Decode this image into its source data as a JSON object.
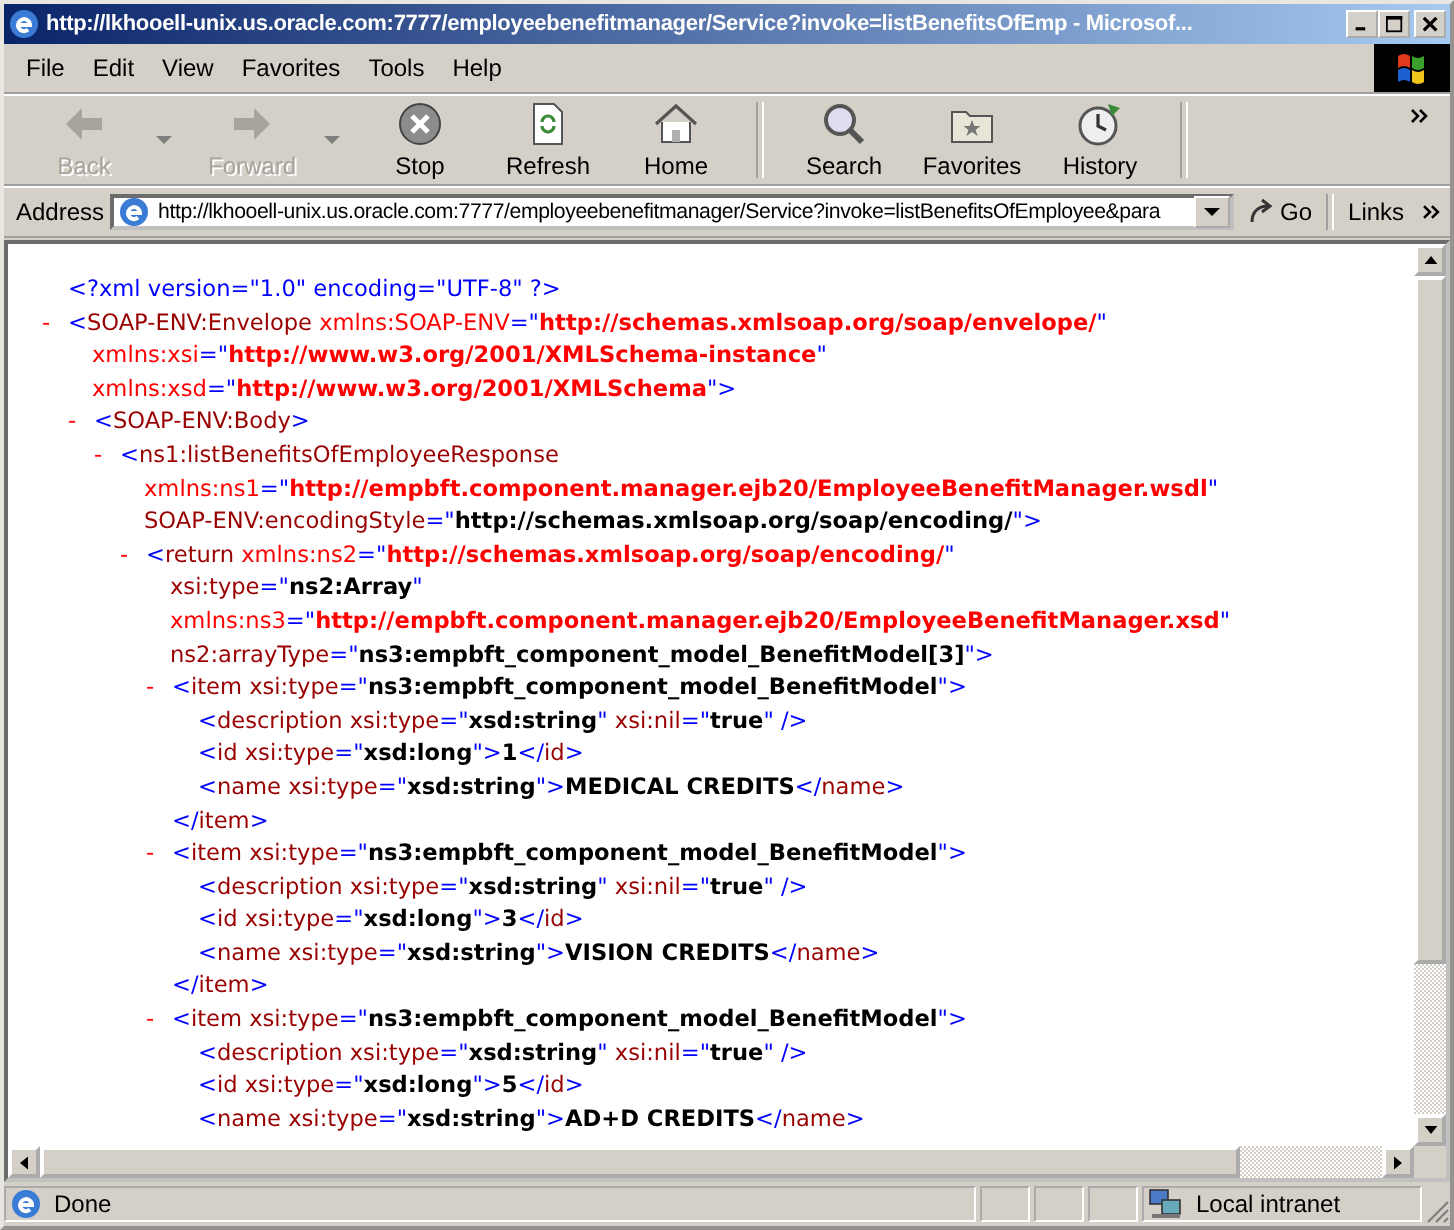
{
  "window": {
    "title": "http://lkhooell-unix.us.oracle.com:7777/employeebenefitmanager/Service?invoke=listBenefitsOfEmp - Microsof..."
  },
  "menu": [
    "File",
    "Edit",
    "View",
    "Favorites",
    "Tools",
    "Help"
  ],
  "toolbar": [
    {
      "kind": "back",
      "label": "Back",
      "disabled": true,
      "dropdown": true
    },
    {
      "kind": "forward",
      "label": "Forward",
      "disabled": true,
      "dropdown": true
    },
    {
      "kind": "stop",
      "label": "Stop",
      "disabled": false
    },
    {
      "kind": "refresh",
      "label": "Refresh",
      "disabled": false
    },
    {
      "kind": "home",
      "label": "Home",
      "disabled": false
    },
    {
      "kind": "search",
      "label": "Search",
      "disabled": false
    },
    {
      "kind": "favorites",
      "label": "Favorites",
      "disabled": false
    },
    {
      "kind": "history",
      "label": "History",
      "disabled": false
    }
  ],
  "address": {
    "label": "Address",
    "value": "http://lkhooell-unix.us.oracle.com:7777/employeebenefitmanager/Service?invoke=listBenefitsOfEmployee&para",
    "go": "Go",
    "links": "Links"
  },
  "document": {
    "declaration": [
      {
        "kind": "mark",
        "text": "<?xml version=\"1.0\" encoding=\"UTF-8\" ?>"
      }
    ],
    "nodes": [
      {
        "toggle": "-",
        "lines": [
          [
            {
              "kind": "mark",
              "text": "<"
            },
            {
              "kind": "tag",
              "text": "SOAP-ENV:Envelope"
            },
            {
              "kind": "nsattr",
              "text": " xmlns:SOAP-ENV"
            },
            {
              "kind": "mark",
              "text": "=\""
            },
            {
              "kind": "nsvalue",
              "text": "http://schemas.xmlsoap.org/soap/envelope/"
            },
            {
              "kind": "mark",
              "text": "\""
            }
          ],
          [
            {
              "kind": "nsattr",
              "text": "xmlns:xsi"
            },
            {
              "kind": "mark",
              "text": "=\""
            },
            {
              "kind": "nsvalue",
              "text": "http://www.w3.org/2001/XMLSchema-instance"
            },
            {
              "kind": "mark",
              "text": "\""
            }
          ],
          [
            {
              "kind": "nsattr",
              "text": "xmlns:xsd"
            },
            {
              "kind": "mark",
              "text": "=\""
            },
            {
              "kind": "nsvalue",
              "text": "http://www.w3.org/2001/XMLSchema"
            },
            {
              "kind": "mark",
              "text": "\">"
            }
          ]
        ],
        "children": [
          {
            "toggle": "-",
            "lines": [
              [
                {
                  "kind": "mark",
                  "text": "<"
                },
                {
                  "kind": "tag",
                  "text": "SOAP-ENV:Body"
                },
                {
                  "kind": "mark",
                  "text": ">"
                }
              ]
            ],
            "children": [
              {
                "toggle": "-",
                "lines": [
                  [
                    {
                      "kind": "mark",
                      "text": "<"
                    },
                    {
                      "kind": "tag",
                      "text": "ns1:listBenefitsOfEmployeeResponse"
                    }
                  ],
                  [
                    {
                      "kind": "nsattr",
                      "text": "xmlns:ns1"
                    },
                    {
                      "kind": "mark",
                      "text": "=\""
                    },
                    {
                      "kind": "nsvalue",
                      "text": "http://empbft.component.manager.ejb20/EmployeeBenefitManager.wsdl"
                    },
                    {
                      "kind": "mark",
                      "text": "\""
                    }
                  ],
                  [
                    {
                      "kind": "attr",
                      "text": "SOAP-ENV:encodingStyle"
                    },
                    {
                      "kind": "mark",
                      "text": "=\""
                    },
                    {
                      "kind": "value",
                      "text": "http://schemas.xmlsoap.org/soap/encoding/"
                    },
                    {
                      "kind": "mark",
                      "text": "\">"
                    }
                  ]
                ],
                "children": [
                  {
                    "toggle": "-",
                    "lines": [
                      [
                        {
                          "kind": "mark",
                          "text": "<"
                        },
                        {
                          "kind": "tag",
                          "text": "return"
                        },
                        {
                          "kind": "nsattr",
                          "text": " xmlns:ns2"
                        },
                        {
                          "kind": "mark",
                          "text": "=\""
                        },
                        {
                          "kind": "nsvalue",
                          "text": "http://schemas.xmlsoap.org/soap/encoding/"
                        },
                        {
                          "kind": "mark",
                          "text": "\""
                        }
                      ],
                      [
                        {
                          "kind": "attr",
                          "text": "xsi:type"
                        },
                        {
                          "kind": "mark",
                          "text": "=\""
                        },
                        {
                          "kind": "value",
                          "text": "ns2:Array"
                        },
                        {
                          "kind": "mark",
                          "text": "\""
                        }
                      ],
                      [
                        {
                          "kind": "nsattr",
                          "text": "xmlns:ns3"
                        },
                        {
                          "kind": "mark",
                          "text": "=\""
                        },
                        {
                          "kind": "nsvalue",
                          "text": "http://empbft.component.manager.ejb20/EmployeeBenefitManager.xsd"
                        },
                        {
                          "kind": "mark",
                          "text": "\""
                        }
                      ],
                      [
                        {
                          "kind": "attr",
                          "text": "ns2:arrayType"
                        },
                        {
                          "kind": "mark",
                          "text": "=\""
                        },
                        {
                          "kind": "value",
                          "text": "ns3:empbft_component_model_BenefitModel[3]"
                        },
                        {
                          "kind": "mark",
                          "text": "\">"
                        }
                      ]
                    ],
                    "children": [
                      {
                        "toggle": "-",
                        "lines": [
                          [
                            {
                              "kind": "mark",
                              "text": "<"
                            },
                            {
                              "kind": "tag",
                              "text": "item"
                            },
                            {
                              "kind": "attr",
                              "text": " xsi:type"
                            },
                            {
                              "kind": "mark",
                              "text": "=\""
                            },
                            {
                              "kind": "value",
                              "text": "ns3:empbft_component_model_BenefitModel"
                            },
                            {
                              "kind": "mark",
                              "text": "\">"
                            }
                          ]
                        ],
                        "children": [
                          {
                            "lines": [
                              [
                                {
                                  "kind": "mark",
                                  "text": "<"
                                },
                                {
                                  "kind": "tag",
                                  "text": "description"
                                },
                                {
                                  "kind": "attr",
                                  "text": " xsi:type"
                                },
                                {
                                  "kind": "mark",
                                  "text": "=\""
                                },
                                {
                                  "kind": "value",
                                  "text": "xsd:string"
                                },
                                {
                                  "kind": "mark",
                                  "text": "\""
                                },
                                {
                                  "kind": "attr",
                                  "text": " xsi:nil"
                                },
                                {
                                  "kind": "mark",
                                  "text": "=\""
                                },
                                {
                                  "kind": "value",
                                  "text": "true"
                                },
                                {
                                  "kind": "mark",
                                  "text": "\" />"
                                }
                              ]
                            ]
                          },
                          {
                            "lines": [
                              [
                                {
                                  "kind": "mark",
                                  "text": "<"
                                },
                                {
                                  "kind": "tag",
                                  "text": "id"
                                },
                                {
                                  "kind": "attr",
                                  "text": " xsi:type"
                                },
                                {
                                  "kind": "mark",
                                  "text": "=\""
                                },
                                {
                                  "kind": "value",
                                  "text": "xsd:long"
                                },
                                {
                                  "kind": "mark",
                                  "text": "\">"
                                },
                                {
                                  "kind": "text",
                                  "text": "1"
                                },
                                {
                                  "kind": "mark",
                                  "text": "</"
                                },
                                {
                                  "kind": "tag",
                                  "text": "id"
                                },
                                {
                                  "kind": "mark",
                                  "text": ">"
                                }
                              ]
                            ]
                          },
                          {
                            "lines": [
                              [
                                {
                                  "kind": "mark",
                                  "text": "<"
                                },
                                {
                                  "kind": "tag",
                                  "text": "name"
                                },
                                {
                                  "kind": "attr",
                                  "text": " xsi:type"
                                },
                                {
                                  "kind": "mark",
                                  "text": "=\""
                                },
                                {
                                  "kind": "value",
                                  "text": "xsd:string"
                                },
                                {
                                  "kind": "mark",
                                  "text": "\">"
                                },
                                {
                                  "kind": "text",
                                  "text": "MEDICAL CREDITS"
                                },
                                {
                                  "kind": "mark",
                                  "text": "</"
                                },
                                {
                                  "kind": "tag",
                                  "text": "name"
                                },
                                {
                                  "kind": "mark",
                                  "text": ">"
                                }
                              ]
                            ]
                          }
                        ],
                        "close": [
                          {
                            "kind": "mark",
                            "text": "</"
                          },
                          {
                            "kind": "tag",
                            "text": "item"
                          },
                          {
                            "kind": "mark",
                            "text": ">"
                          }
                        ]
                      },
                      {
                        "toggle": "-",
                        "lines": [
                          [
                            {
                              "kind": "mark",
                              "text": "<"
                            },
                            {
                              "kind": "tag",
                              "text": "item"
                            },
                            {
                              "kind": "attr",
                              "text": " xsi:type"
                            },
                            {
                              "kind": "mark",
                              "text": "=\""
                            },
                            {
                              "kind": "value",
                              "text": "ns3:empbft_component_model_BenefitModel"
                            },
                            {
                              "kind": "mark",
                              "text": "\">"
                            }
                          ]
                        ],
                        "children": [
                          {
                            "lines": [
                              [
                                {
                                  "kind": "mark",
                                  "text": "<"
                                },
                                {
                                  "kind": "tag",
                                  "text": "description"
                                },
                                {
                                  "kind": "attr",
                                  "text": " xsi:type"
                                },
                                {
                                  "kind": "mark",
                                  "text": "=\""
                                },
                                {
                                  "kind": "value",
                                  "text": "xsd:string"
                                },
                                {
                                  "kind": "mark",
                                  "text": "\""
                                },
                                {
                                  "kind": "attr",
                                  "text": " xsi:nil"
                                },
                                {
                                  "kind": "mark",
                                  "text": "=\""
                                },
                                {
                                  "kind": "value",
                                  "text": "true"
                                },
                                {
                                  "kind": "mark",
                                  "text": "\" />"
                                }
                              ]
                            ]
                          },
                          {
                            "lines": [
                              [
                                {
                                  "kind": "mark",
                                  "text": "<"
                                },
                                {
                                  "kind": "tag",
                                  "text": "id"
                                },
                                {
                                  "kind": "attr",
                                  "text": " xsi:type"
                                },
                                {
                                  "kind": "mark",
                                  "text": "=\""
                                },
                                {
                                  "kind": "value",
                                  "text": "xsd:long"
                                },
                                {
                                  "kind": "mark",
                                  "text": "\">"
                                },
                                {
                                  "kind": "text",
                                  "text": "3"
                                },
                                {
                                  "kind": "mark",
                                  "text": "</"
                                },
                                {
                                  "kind": "tag",
                                  "text": "id"
                                },
                                {
                                  "kind": "mark",
                                  "text": ">"
                                }
                              ]
                            ]
                          },
                          {
                            "lines": [
                              [
                                {
                                  "kind": "mark",
                                  "text": "<"
                                },
                                {
                                  "kind": "tag",
                                  "text": "name"
                                },
                                {
                                  "kind": "attr",
                                  "text": " xsi:type"
                                },
                                {
                                  "kind": "mark",
                                  "text": "=\""
                                },
                                {
                                  "kind": "value",
                                  "text": "xsd:string"
                                },
                                {
                                  "kind": "mark",
                                  "text": "\">"
                                },
                                {
                                  "kind": "text",
                                  "text": "VISION CREDITS"
                                },
                                {
                                  "kind": "mark",
                                  "text": "</"
                                },
                                {
                                  "kind": "tag",
                                  "text": "name"
                                },
                                {
                                  "kind": "mark",
                                  "text": ">"
                                }
                              ]
                            ]
                          }
                        ],
                        "close": [
                          {
                            "kind": "mark",
                            "text": "</"
                          },
                          {
                            "kind": "tag",
                            "text": "item"
                          },
                          {
                            "kind": "mark",
                            "text": ">"
                          }
                        ]
                      },
                      {
                        "toggle": "-",
                        "lines": [
                          [
                            {
                              "kind": "mark",
                              "text": "<"
                            },
                            {
                              "kind": "tag",
                              "text": "item"
                            },
                            {
                              "kind": "attr",
                              "text": " xsi:type"
                            },
                            {
                              "kind": "mark",
                              "text": "=\""
                            },
                            {
                              "kind": "value",
                              "text": "ns3:empbft_component_model_BenefitModel"
                            },
                            {
                              "kind": "mark",
                              "text": "\">"
                            }
                          ]
                        ],
                        "children": [
                          {
                            "lines": [
                              [
                                {
                                  "kind": "mark",
                                  "text": "<"
                                },
                                {
                                  "kind": "tag",
                                  "text": "description"
                                },
                                {
                                  "kind": "attr",
                                  "text": " xsi:type"
                                },
                                {
                                  "kind": "mark",
                                  "text": "=\""
                                },
                                {
                                  "kind": "value",
                                  "text": "xsd:string"
                                },
                                {
                                  "kind": "mark",
                                  "text": "\""
                                },
                                {
                                  "kind": "attr",
                                  "text": " xsi:nil"
                                },
                                {
                                  "kind": "mark",
                                  "text": "=\""
                                },
                                {
                                  "kind": "value",
                                  "text": "true"
                                },
                                {
                                  "kind": "mark",
                                  "text": "\" />"
                                }
                              ]
                            ]
                          },
                          {
                            "lines": [
                              [
                                {
                                  "kind": "mark",
                                  "text": "<"
                                },
                                {
                                  "kind": "tag",
                                  "text": "id"
                                },
                                {
                                  "kind": "attr",
                                  "text": " xsi:type"
                                },
                                {
                                  "kind": "mark",
                                  "text": "=\""
                                },
                                {
                                  "kind": "value",
                                  "text": "xsd:long"
                                },
                                {
                                  "kind": "mark",
                                  "text": "\">"
                                },
                                {
                                  "kind": "text",
                                  "text": "5"
                                },
                                {
                                  "kind": "mark",
                                  "text": "</"
                                },
                                {
                                  "kind": "tag",
                                  "text": "id"
                                },
                                {
                                  "kind": "mark",
                                  "text": ">"
                                }
                              ]
                            ]
                          },
                          {
                            "lines": [
                              [
                                {
                                  "kind": "mark",
                                  "text": "<"
                                },
                                {
                                  "kind": "tag",
                                  "text": "name"
                                },
                                {
                                  "kind": "attr",
                                  "text": " xsi:type"
                                },
                                {
                                  "kind": "mark",
                                  "text": "=\""
                                },
                                {
                                  "kind": "value",
                                  "text": "xsd:string"
                                },
                                {
                                  "kind": "mark",
                                  "text": "\">"
                                },
                                {
                                  "kind": "text",
                                  "text": "AD+D CREDITS"
                                },
                                {
                                  "kind": "mark",
                                  "text": "</"
                                },
                                {
                                  "kind": "tag",
                                  "text": "name"
                                },
                                {
                                  "kind": "mark",
                                  "text": ">"
                                }
                              ]
                            ]
                          }
                        ]
                      }
                    ]
                  }
                ]
              }
            ]
          }
        ]
      }
    ]
  },
  "status_bar": {
    "text": "Done",
    "zone": "Local intranet"
  }
}
